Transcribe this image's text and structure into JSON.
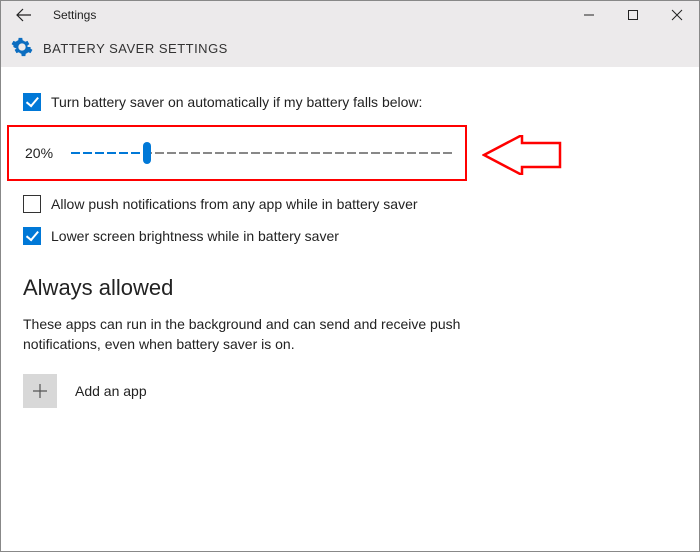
{
  "titlebar": {
    "title": "Settings"
  },
  "header": {
    "page_title": "BATTERY SAVER SETTINGS"
  },
  "options": {
    "auto_on": {
      "checked": true,
      "label": "Turn battery saver on automatically if my battery falls below:"
    },
    "threshold": {
      "percent_label": "20%",
      "percent_value": 20
    },
    "allow_push": {
      "checked": false,
      "label": "Allow push notifications from any app while in battery saver"
    },
    "lower_brightness": {
      "checked": true,
      "label": "Lower screen brightness while in battery saver"
    }
  },
  "always_allowed": {
    "heading": "Always allowed",
    "description": "These apps can run in the background and can send and receive push notifications, even when battery saver is on.",
    "add_label": "Add an app"
  }
}
